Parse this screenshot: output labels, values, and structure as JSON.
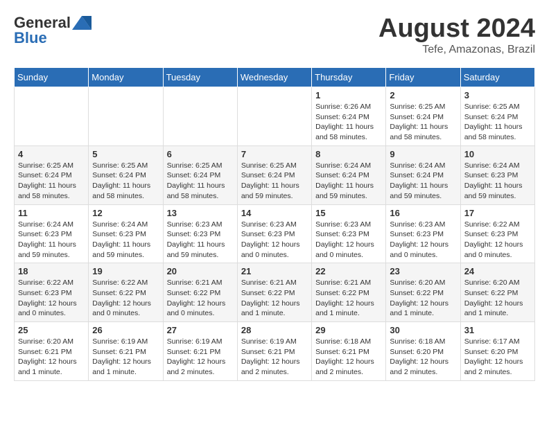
{
  "header": {
    "logo_general": "General",
    "logo_blue": "Blue",
    "month_title": "August 2024",
    "location": "Tefe, Amazonas, Brazil"
  },
  "weekdays": [
    "Sunday",
    "Monday",
    "Tuesday",
    "Wednesday",
    "Thursday",
    "Friday",
    "Saturday"
  ],
  "weeks": [
    [
      {
        "day": "",
        "info": ""
      },
      {
        "day": "",
        "info": ""
      },
      {
        "day": "",
        "info": ""
      },
      {
        "day": "",
        "info": ""
      },
      {
        "day": "1",
        "info": "Sunrise: 6:26 AM\nSunset: 6:24 PM\nDaylight: 11 hours\nand 58 minutes."
      },
      {
        "day": "2",
        "info": "Sunrise: 6:25 AM\nSunset: 6:24 PM\nDaylight: 11 hours\nand 58 minutes."
      },
      {
        "day": "3",
        "info": "Sunrise: 6:25 AM\nSunset: 6:24 PM\nDaylight: 11 hours\nand 58 minutes."
      }
    ],
    [
      {
        "day": "4",
        "info": "Sunrise: 6:25 AM\nSunset: 6:24 PM\nDaylight: 11 hours\nand 58 minutes."
      },
      {
        "day": "5",
        "info": "Sunrise: 6:25 AM\nSunset: 6:24 PM\nDaylight: 11 hours\nand 58 minutes."
      },
      {
        "day": "6",
        "info": "Sunrise: 6:25 AM\nSunset: 6:24 PM\nDaylight: 11 hours\nand 58 minutes."
      },
      {
        "day": "7",
        "info": "Sunrise: 6:25 AM\nSunset: 6:24 PM\nDaylight: 11 hours\nand 59 minutes."
      },
      {
        "day": "8",
        "info": "Sunrise: 6:24 AM\nSunset: 6:24 PM\nDaylight: 11 hours\nand 59 minutes."
      },
      {
        "day": "9",
        "info": "Sunrise: 6:24 AM\nSunset: 6:24 PM\nDaylight: 11 hours\nand 59 minutes."
      },
      {
        "day": "10",
        "info": "Sunrise: 6:24 AM\nSunset: 6:23 PM\nDaylight: 11 hours\nand 59 minutes."
      }
    ],
    [
      {
        "day": "11",
        "info": "Sunrise: 6:24 AM\nSunset: 6:23 PM\nDaylight: 11 hours\nand 59 minutes."
      },
      {
        "day": "12",
        "info": "Sunrise: 6:24 AM\nSunset: 6:23 PM\nDaylight: 11 hours\nand 59 minutes."
      },
      {
        "day": "13",
        "info": "Sunrise: 6:23 AM\nSunset: 6:23 PM\nDaylight: 11 hours\nand 59 minutes."
      },
      {
        "day": "14",
        "info": "Sunrise: 6:23 AM\nSunset: 6:23 PM\nDaylight: 12 hours\nand 0 minutes."
      },
      {
        "day": "15",
        "info": "Sunrise: 6:23 AM\nSunset: 6:23 PM\nDaylight: 12 hours\nand 0 minutes."
      },
      {
        "day": "16",
        "info": "Sunrise: 6:23 AM\nSunset: 6:23 PM\nDaylight: 12 hours\nand 0 minutes."
      },
      {
        "day": "17",
        "info": "Sunrise: 6:22 AM\nSunset: 6:23 PM\nDaylight: 12 hours\nand 0 minutes."
      }
    ],
    [
      {
        "day": "18",
        "info": "Sunrise: 6:22 AM\nSunset: 6:23 PM\nDaylight: 12 hours\nand 0 minutes."
      },
      {
        "day": "19",
        "info": "Sunrise: 6:22 AM\nSunset: 6:22 PM\nDaylight: 12 hours\nand 0 minutes."
      },
      {
        "day": "20",
        "info": "Sunrise: 6:21 AM\nSunset: 6:22 PM\nDaylight: 12 hours\nand 0 minutes."
      },
      {
        "day": "21",
        "info": "Sunrise: 6:21 AM\nSunset: 6:22 PM\nDaylight: 12 hours\nand 1 minute."
      },
      {
        "day": "22",
        "info": "Sunrise: 6:21 AM\nSunset: 6:22 PM\nDaylight: 12 hours\nand 1 minute."
      },
      {
        "day": "23",
        "info": "Sunrise: 6:20 AM\nSunset: 6:22 PM\nDaylight: 12 hours\nand 1 minute."
      },
      {
        "day": "24",
        "info": "Sunrise: 6:20 AM\nSunset: 6:22 PM\nDaylight: 12 hours\nand 1 minute."
      }
    ],
    [
      {
        "day": "25",
        "info": "Sunrise: 6:20 AM\nSunset: 6:21 PM\nDaylight: 12 hours\nand 1 minute."
      },
      {
        "day": "26",
        "info": "Sunrise: 6:19 AM\nSunset: 6:21 PM\nDaylight: 12 hours\nand 1 minute."
      },
      {
        "day": "27",
        "info": "Sunrise: 6:19 AM\nSunset: 6:21 PM\nDaylight: 12 hours\nand 2 minutes."
      },
      {
        "day": "28",
        "info": "Sunrise: 6:19 AM\nSunset: 6:21 PM\nDaylight: 12 hours\nand 2 minutes."
      },
      {
        "day": "29",
        "info": "Sunrise: 6:18 AM\nSunset: 6:21 PM\nDaylight: 12 hours\nand 2 minutes."
      },
      {
        "day": "30",
        "info": "Sunrise: 6:18 AM\nSunset: 6:20 PM\nDaylight: 12 hours\nand 2 minutes."
      },
      {
        "day": "31",
        "info": "Sunrise: 6:17 AM\nSunset: 6:20 PM\nDaylight: 12 hours\nand 2 minutes."
      }
    ]
  ]
}
